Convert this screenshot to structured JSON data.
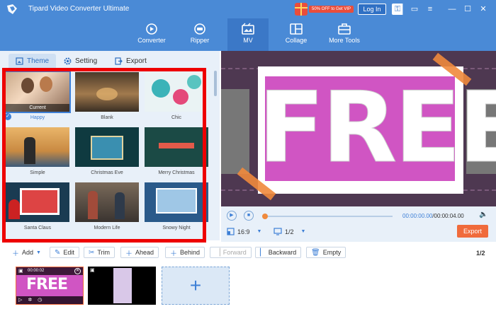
{
  "app": {
    "title": "Tipard Video Converter Ultimate",
    "promo_badge": "50% OFF to Get VIP",
    "login_label": "Log In",
    "brand_color": "#4a8ad6"
  },
  "main_tabs": [
    {
      "label": "Converter",
      "icon": "converter-icon"
    },
    {
      "label": "Ripper",
      "icon": "ripper-icon"
    },
    {
      "label": "MV",
      "icon": "mv-icon",
      "active": true
    },
    {
      "label": "Collage",
      "icon": "collage-icon"
    },
    {
      "label": "More Tools",
      "icon": "toolbox-icon"
    }
  ],
  "sub_tabs": [
    {
      "label": "Theme",
      "icon": "theme-icon",
      "active": true
    },
    {
      "label": "Setting",
      "icon": "gear-icon"
    },
    {
      "label": "Export",
      "icon": "export-icon"
    }
  ],
  "themes": [
    {
      "label": "Happy",
      "selected": true,
      "tag": "Current"
    },
    {
      "label": "Blank"
    },
    {
      "label": "Chic"
    },
    {
      "label": "Simple"
    },
    {
      "label": "Christmas Eve"
    },
    {
      "label": "Merry Christmas"
    },
    {
      "label": "Santa Claus"
    },
    {
      "label": "Modern Life"
    },
    {
      "label": "Snowy Night"
    }
  ],
  "preview": {
    "text": "FREE"
  },
  "player": {
    "current_time": "00:00:00.00",
    "total_time": "/00:00:04.00",
    "aspect_ratio": "16:9",
    "page": "1/2",
    "export_label": "Export",
    "export_color": "#f06b3c"
  },
  "toolbar": {
    "add_label": "Add",
    "edit_label": "Edit",
    "trim_label": "Trim",
    "ahead_label": "Ahead",
    "behind_label": "Behind",
    "forward_label": "Forward",
    "backward_label": "Backward",
    "empty_label": "Empty",
    "page_count": "1/2"
  },
  "clips": [
    {
      "duration": "00:00:02",
      "text": "FREE"
    },
    {}
  ]
}
